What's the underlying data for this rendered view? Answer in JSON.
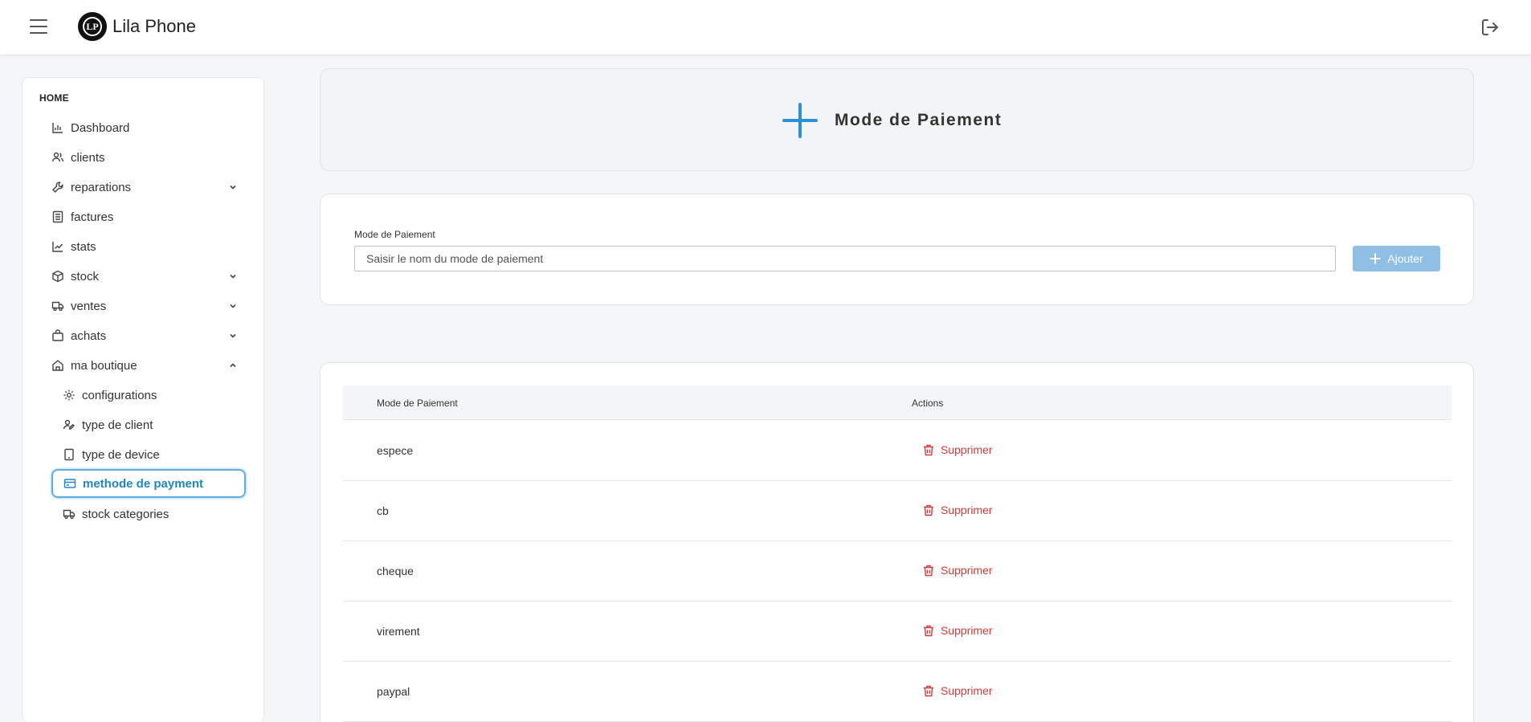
{
  "app": {
    "title": "Lila Phone",
    "logo_text": "LP"
  },
  "sidebar": {
    "section": "HOME",
    "items": [
      {
        "label": "Dashboard"
      },
      {
        "label": "clients"
      },
      {
        "label": "reparations"
      },
      {
        "label": "factures"
      },
      {
        "label": "stats"
      },
      {
        "label": "stock"
      },
      {
        "label": "ventes"
      },
      {
        "label": "achats"
      },
      {
        "label": "ma boutique"
      }
    ],
    "subitems": [
      {
        "label": "configurations"
      },
      {
        "label": "type de client"
      },
      {
        "label": "type de device"
      },
      {
        "label": "methode de payment"
      },
      {
        "label": "stock categories"
      }
    ]
  },
  "hero": {
    "title": "Mode de Paiement"
  },
  "form": {
    "label": "Mode de Paiement",
    "placeholder": "Saisir le nom du mode de paiement",
    "value": "",
    "button": "Ajouter"
  },
  "table": {
    "columns": [
      "Mode de Paiement",
      "Actions"
    ],
    "rows": [
      {
        "name": "espece",
        "action": "Supprimer"
      },
      {
        "name": "cb",
        "action": "Supprimer"
      },
      {
        "name": "cheque",
        "action": "Supprimer"
      },
      {
        "name": "virement",
        "action": "Supprimer"
      },
      {
        "name": "paypal",
        "action": "Supprimer"
      }
    ]
  },
  "colors": {
    "accent": "#1d87c8",
    "danger": "#d63a3a",
    "button": "#8fbfe4"
  }
}
